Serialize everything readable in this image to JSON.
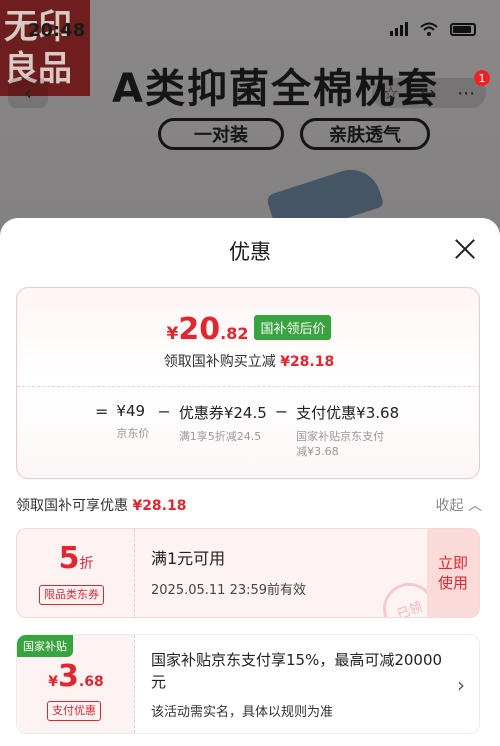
{
  "status": {
    "time": "20:48"
  },
  "background": {
    "logo_text": "无印良品",
    "headline": "A类抑菌全棉枕套",
    "pills": [
      "一对装",
      "亲肤透气"
    ],
    "cart_badge": "1"
  },
  "sheet": {
    "title": "优惠",
    "price_card": {
      "currency": "¥",
      "price_int": "20",
      "price_dec": ".82",
      "tag": "国补领后价",
      "subtitle_prefix": "领取国补购买立减",
      "subtitle_amount": "¥28.18",
      "formula": {
        "eq": "=",
        "jd_price": "¥49",
        "jd_price_note": "京东价",
        "minus1": "−",
        "coupon": "优惠券¥24.5",
        "coupon_note": "满1享5折减24.5",
        "minus2": "−",
        "pay": "支付优惠¥3.68",
        "pay_note_line1": "国家补贴京东支付",
        "pay_note_line2": "减¥3.68"
      }
    },
    "section": {
      "title_prefix": "领取国补可享优惠",
      "title_amount": "¥28.18",
      "collapse_label": "收起",
      "collapse_icon": "chevron-up-icon"
    },
    "coupon": {
      "discount_number": "5",
      "discount_unit": "折",
      "tag": "限品类东券",
      "title": "满1元可用",
      "expiry": "2025.05.11 23:59前有效",
      "use_label_line1": "立即",
      "use_label_line2": "使用",
      "stamp": "已领"
    },
    "gov_subsidy": {
      "badge": "国家补贴",
      "currency": "¥",
      "amount_int": "3",
      "amount_dec": ".68",
      "tag": "支付优惠",
      "title": "国家补贴京东支付享15%，最高可减20000元",
      "note": "该活动需实名，具体以规则为准",
      "chevron": "›"
    }
  },
  "colors": {
    "accent_red": "#e0262f",
    "gov_green": "#38a33f"
  }
}
